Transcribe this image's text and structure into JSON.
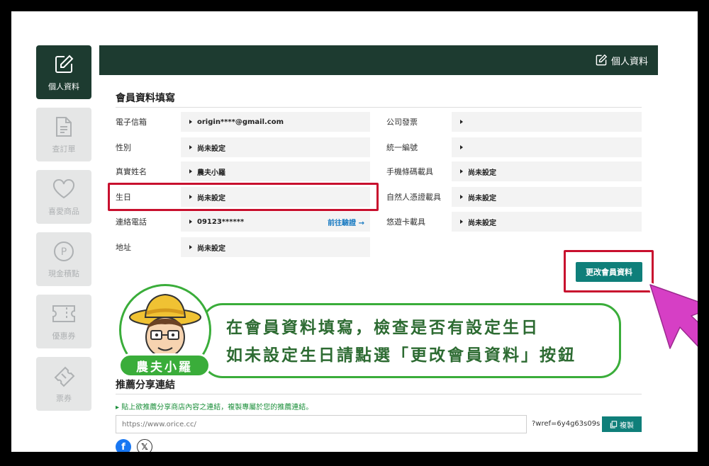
{
  "sidebar": {
    "items": [
      {
        "label": "個人資料",
        "icon": "edit-icon",
        "active": true
      },
      {
        "label": "查訂單",
        "icon": "document-icon",
        "active": false
      },
      {
        "label": "喜愛商品",
        "icon": "heart-icon",
        "active": false
      },
      {
        "label": "現金積點",
        "icon": "points-icon",
        "active": false
      },
      {
        "label": "優惠券",
        "icon": "coupon-icon",
        "active": false
      },
      {
        "label": "票券",
        "icon": "ticket-icon",
        "active": false
      }
    ],
    "points_glyph": "P"
  },
  "header": {
    "title": "個人資料"
  },
  "form": {
    "title": "會員資料填寫",
    "left": [
      {
        "label": "電子信箱",
        "value": "origin****@gmail.com"
      },
      {
        "label": "性別",
        "value": "尚未設定"
      },
      {
        "label": "真實姓名",
        "value": "農夫小羅"
      },
      {
        "label": "生日",
        "value": "尚未設定"
      },
      {
        "label": "連絡電話",
        "value": "09123******",
        "link": "前往驗證 →"
      },
      {
        "label": "地址",
        "value": "尚未設定"
      }
    ],
    "right": [
      {
        "label": "公司發票",
        "value": ""
      },
      {
        "label": "統一編號",
        "value": ""
      },
      {
        "label": "手機條碼載具",
        "value": "尚未設定"
      },
      {
        "label": "自然人憑證載具",
        "value": "尚未設定"
      },
      {
        "label": "悠遊卡載具",
        "value": "尚未設定"
      }
    ],
    "update_button": "更改會員資料"
  },
  "share": {
    "title": "推薦分享連結",
    "note": "▸ 貼上欲推薦分享商店內容之連結，複製專屬於您的推薦連結。",
    "url_placeholder": "https://www.orice.cc/",
    "wref": "?wref=6y4g63s09s",
    "copy_button": "複製",
    "social": [
      {
        "name": "facebook",
        "glyph": "f",
        "color": "#1877f2"
      },
      {
        "name": "x",
        "glyph": "𝕏",
        "color": "#111111"
      }
    ]
  },
  "callout": {
    "line1": "在會員資料填寫，檢查是否有設定生日",
    "line2": "如未設定生日請點選「更改會員資料」按鈕",
    "name": "農夫小羅"
  },
  "colors": {
    "dark_green": "#1d3b30",
    "teal": "#0f7f7a",
    "highlight_red": "#c8102e",
    "callout_green": "#3aad3a",
    "cursor_pink": "#d63fc5"
  }
}
